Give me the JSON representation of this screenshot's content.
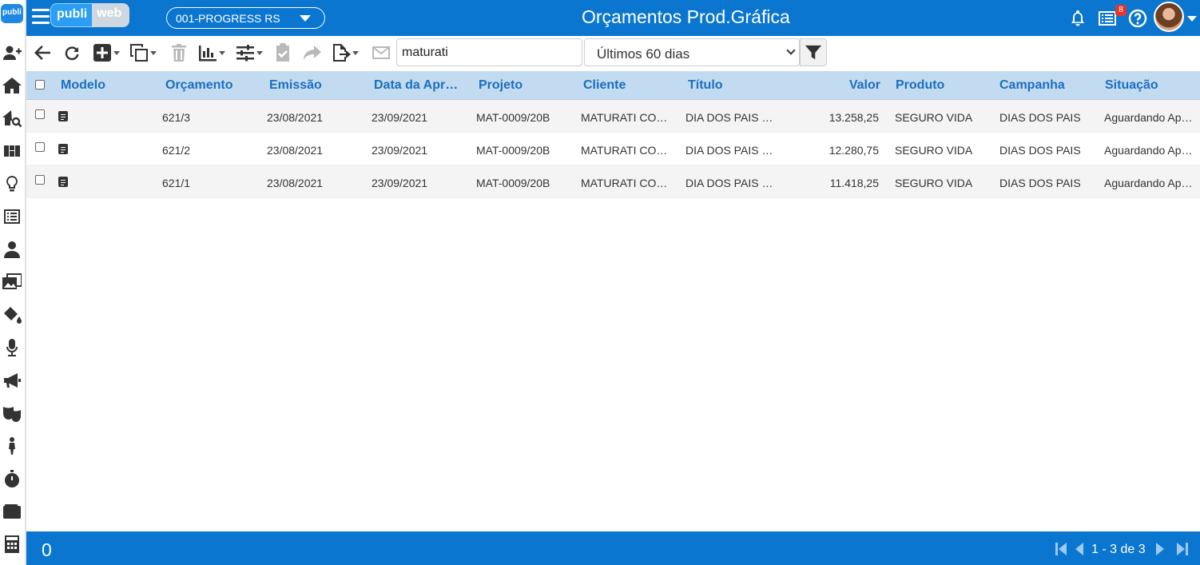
{
  "app": {
    "logo_small": "publi",
    "brand_left": "publi",
    "brand_right": "web",
    "company": "001-PROGRESS RS",
    "title": "Orçamentos Prod.Gráfica",
    "notification_badge": "8"
  },
  "sidebar": {
    "items": [
      "add-user",
      "home",
      "home-search",
      "dashboard",
      "lightbulb",
      "list",
      "people",
      "media",
      "paint-bucket",
      "microphone",
      "megaphone",
      "theater-masks",
      "person",
      "stopwatch",
      "wallet",
      "calculator"
    ]
  },
  "toolbar": {
    "search_value": "maturati",
    "period_value": "Últimos 60 dias"
  },
  "grid": {
    "columns": [
      "Modelo",
      "Orçamento",
      "Emissão",
      "Data da Apr…",
      "Projeto",
      "Cliente",
      "Título",
      "Valor",
      "Produto",
      "Campanha",
      "Situação"
    ],
    "rows": [
      {
        "orcamento": "621/3",
        "emissao": "23/08/2021",
        "data_apr": "23/09/2021",
        "projeto": "MAT-0009/20B",
        "cliente": "MATURATI CO…",
        "titulo": "DIA DOS PAIS …",
        "valor": "13.258,25",
        "produto": "SEGURO VIDA",
        "campanha": "DIAS DOS PAIS",
        "situacao": "Aguardando Ap…"
      },
      {
        "orcamento": "621/2",
        "emissao": "23/08/2021",
        "data_apr": "23/09/2021",
        "projeto": "MAT-0009/20B",
        "cliente": "MATURATI CO…",
        "titulo": "DIA DOS PAIS …",
        "valor": "12.280,75",
        "produto": "SEGURO VIDA",
        "campanha": "DIAS DOS PAIS",
        "situacao": "Aguardando Ap…"
      },
      {
        "orcamento": "621/1",
        "emissao": "23/08/2021",
        "data_apr": "23/09/2021",
        "projeto": "MAT-0009/20B",
        "cliente": "MATURATI CO…",
        "titulo": "DIA DOS PAIS …",
        "valor": "11.418,25",
        "produto": "SEGURO VIDA",
        "campanha": "DIAS DOS PAIS",
        "situacao": "Aguardando Ap…"
      }
    ]
  },
  "footer": {
    "selected_count": "0",
    "pagination": "1 - 3 de 3"
  }
}
